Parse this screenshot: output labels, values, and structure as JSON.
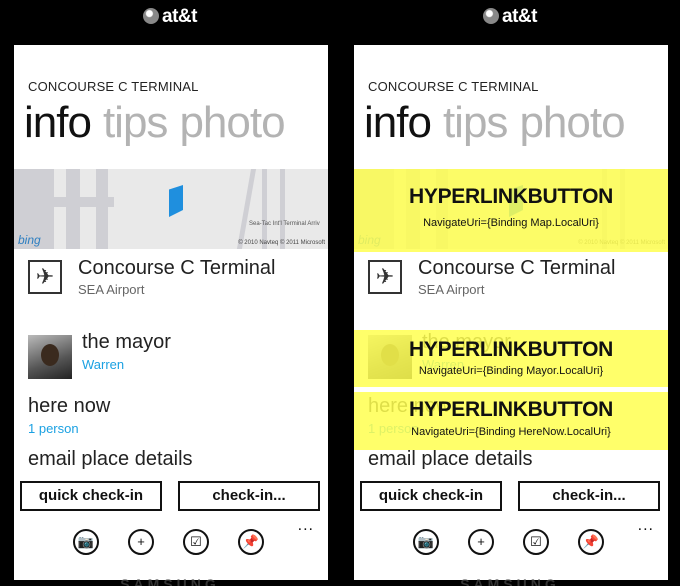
{
  "carrier": "at&t",
  "brand": "SAMSUNG",
  "app_title": "CONCOURSE C TERMINAL",
  "pivots": [
    "info",
    "tips",
    "photo"
  ],
  "map": {
    "bing": "bing",
    "copyright": "© 2010 Navteq © 2011 Microsoft",
    "street": "Sea-Tac Int'l Terminal Arriv"
  },
  "place": {
    "name": "Concourse C Terminal",
    "location": "SEA Airport"
  },
  "mayor": {
    "label": "the mayor",
    "name": "Warren"
  },
  "here_now": {
    "label": "here now",
    "count": "1 person"
  },
  "email_label": "email place details",
  "buttons": {
    "quick_checkin": "quick check-in",
    "checkin": "check-in..."
  },
  "appbar": {
    "more": "..."
  },
  "overlays": [
    {
      "title": "HYPERLINKBUTTON",
      "binding": "NavigateUri={Binding Map.LocalUri}"
    },
    {
      "title": "HYPERLINKBUTTON",
      "binding": "NavigateUri={Binding Mayor.LocalUri}"
    },
    {
      "title": "HYPERLINKBUTTON",
      "binding": "NavigateUri={Binding HereNow.LocalUri}"
    }
  ],
  "colors": {
    "accent": "#1ba1e2",
    "overlay": "#ffff50"
  }
}
